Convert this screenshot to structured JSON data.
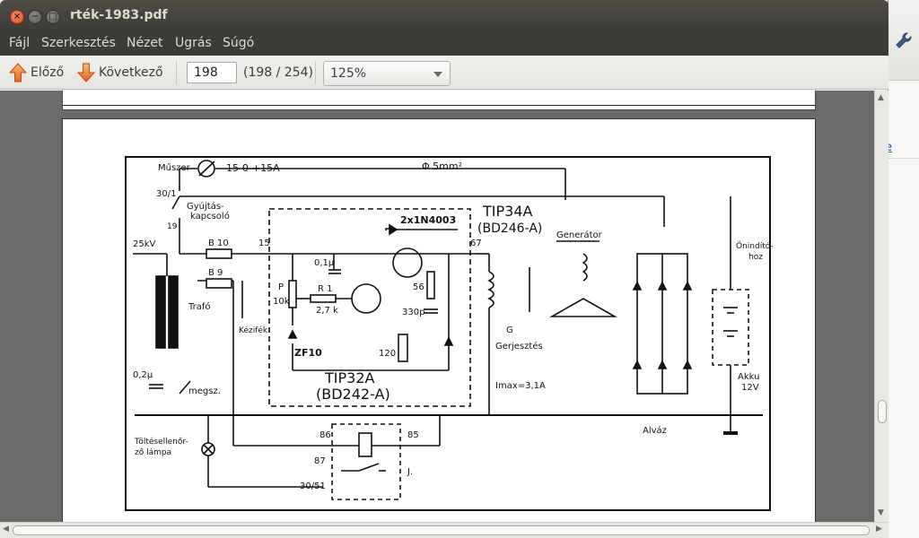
{
  "window": {
    "title": "rték-1983.pdf",
    "controls": {
      "close": "×",
      "minimize": "−",
      "maximize": "□"
    }
  },
  "menubar": {
    "items": [
      "Fájl",
      "Szerkesztés",
      "Nézet",
      "Ugrás",
      "Súgó"
    ]
  },
  "toolbar": {
    "prev_label": "Előző",
    "next_label": "Következő",
    "page_value": "198",
    "page_count": "(198 / 254)",
    "zoom_value": "125%"
  },
  "icons": {
    "prev": "arrow-up-icon",
    "next": "arrow-down-icon",
    "wrench": "wrench-icon"
  },
  "background_window": {
    "link_fragment": "e"
  },
  "document": {
    "labels": {
      "meter": "Műszer",
      "meter_range": "-15-0-+15A",
      "wire": "Φ 5mm²",
      "t30_1": "30/1",
      "ignition": "Gyújtás-",
      "ignition2": "kapcsoló",
      "n19": "19",
      "hv": "25kV",
      "b10": "B 10",
      "b9": "B 9",
      "trafo": "Trafó",
      "n15": "15",
      "diodes": "2x1N4003",
      "tip34": "TIP34A",
      "bd246": "(BD246-A)",
      "generator": "Generátor",
      "starter": "Önindító-",
      "starter2": "hoz",
      "cap01": "0,1μ",
      "p": "P",
      "p10k": "10k",
      "r1": "R 1",
      "r27k": "2,7 k",
      "r56": "56",
      "c330": "330p",
      "r120": "120",
      "zf10": "ZF10",
      "manual": "Kézifék",
      "n67": "67",
      "g": "G",
      "excitation": "Gerjesztés",
      "imax": "Imax=3,1A",
      "tip32": "TIP32A",
      "bd242": "(BD242-A)",
      "cap02": "0,2μ",
      "megsz": "megsz.",
      "akku": "Akku",
      "v12": "12V",
      "charge1": "Töltésellenőr-",
      "charge2": "ző lámpa",
      "n86": "86",
      "n85": "85",
      "n87": "87",
      "n30_51": "30/51",
      "chassis": "Alváz",
      "j": "J."
    }
  }
}
